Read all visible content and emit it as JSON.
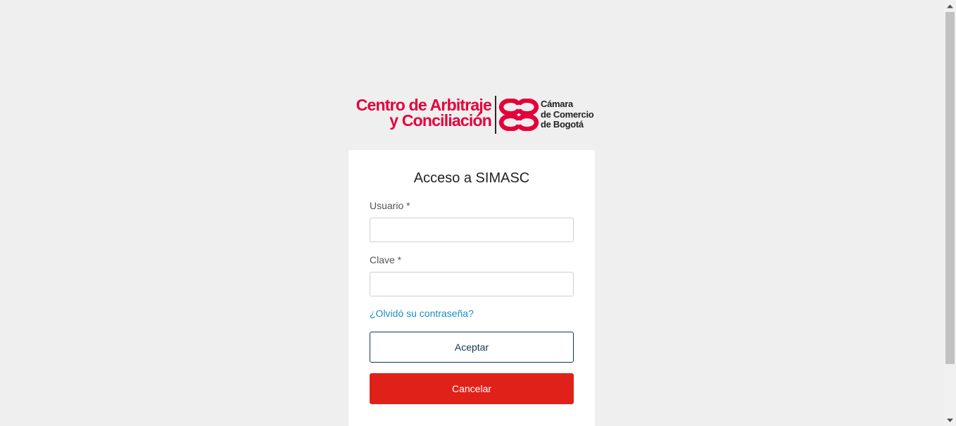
{
  "logo": {
    "left_line1": "Centro de Arbitraje",
    "left_line2": "y Conciliación",
    "right_line1": "Cámara",
    "right_line2": "de Comercio",
    "right_line3": "de Bogotá",
    "brand_color": "#e4003b"
  },
  "login": {
    "title": "Acceso a SIMASC",
    "username_label": "Usuario *",
    "username_value": "",
    "password_label": "Clave *",
    "password_value": "",
    "forgot_link": "¿Olvidó su contraseña?",
    "accept_button": "Aceptar",
    "cancel_button": "Cancelar"
  },
  "colors": {
    "background": "#efefef",
    "accept_border": "#12345a",
    "cancel_bg": "#e0211a",
    "link": "#1a8fc9"
  },
  "icons": {
    "scroll_up": "triangle-up",
    "scroll_down": "triangle-down",
    "logo_mark": "ccb-double-c-mark"
  }
}
